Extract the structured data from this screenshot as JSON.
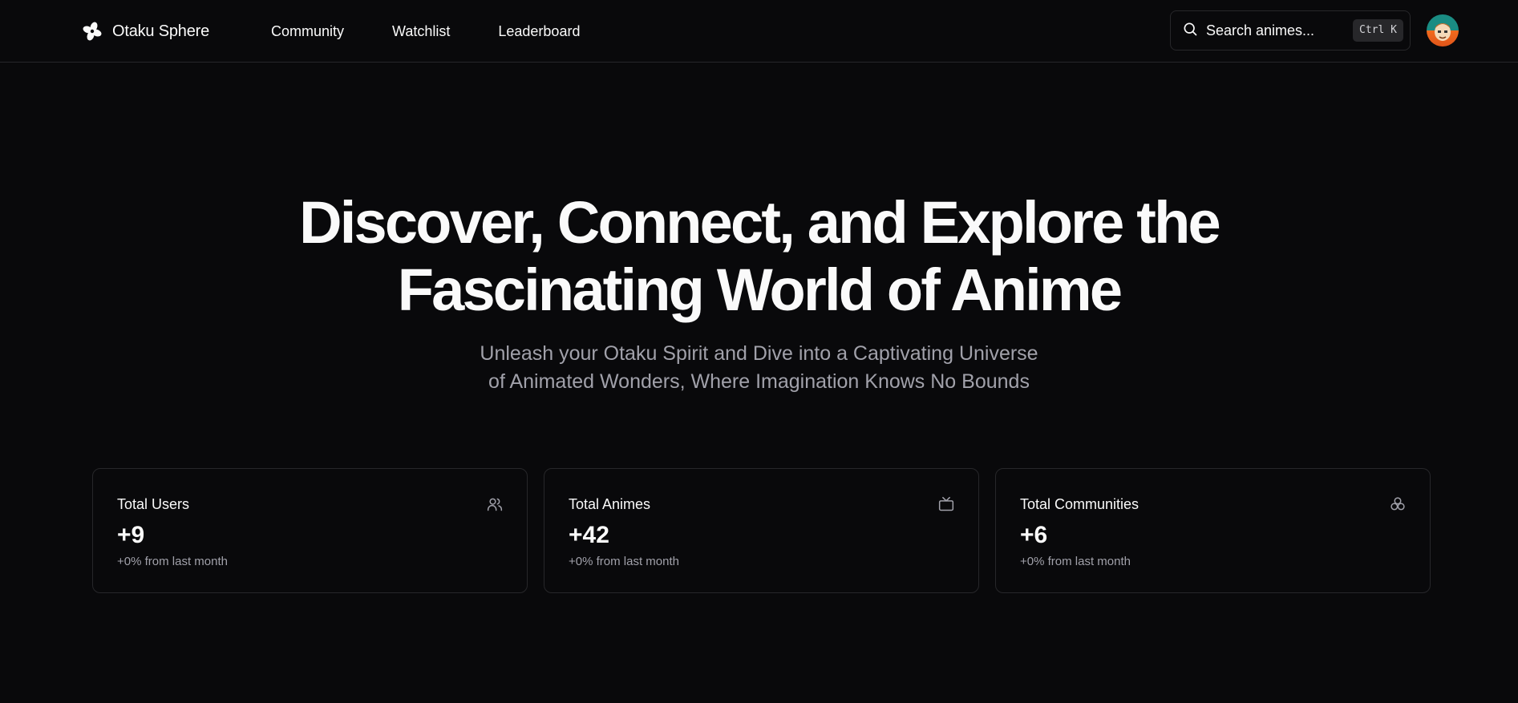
{
  "header": {
    "brand": {
      "name": "Otaku Sphere",
      "icon": "flower-logo-icon"
    },
    "nav": [
      {
        "label": "Community"
      },
      {
        "label": "Watchlist"
      },
      {
        "label": "Leaderboard"
      }
    ],
    "search": {
      "placeholder": "Search animes...",
      "shortcut": "Ctrl K",
      "icon": "search-icon"
    },
    "avatar": {
      "icon": "user-avatar"
    }
  },
  "hero": {
    "title_line1": "Discover, Connect, and Explore the",
    "title_line2": "Fascinating World of Anime",
    "subtitle_line1": "Unleash your Otaku Spirit and Dive into a Captivating Universe",
    "subtitle_line2": "of Animated Wonders, Where Imagination Knows No Bounds"
  },
  "stats": [
    {
      "title": "Total Users",
      "value": "+9",
      "delta": "+0% from last month",
      "icon": "users-icon"
    },
    {
      "title": "Total Animes",
      "value": "+42",
      "delta": "+0% from last month",
      "icon": "tv-icon"
    },
    {
      "title": "Total Communities",
      "value": "+6",
      "delta": "+0% from last month",
      "icon": "communities-icon"
    }
  ],
  "colors": {
    "background": "#09090b",
    "border": "#27272a",
    "text": "#fafafa",
    "muted": "#a1a1aa"
  }
}
